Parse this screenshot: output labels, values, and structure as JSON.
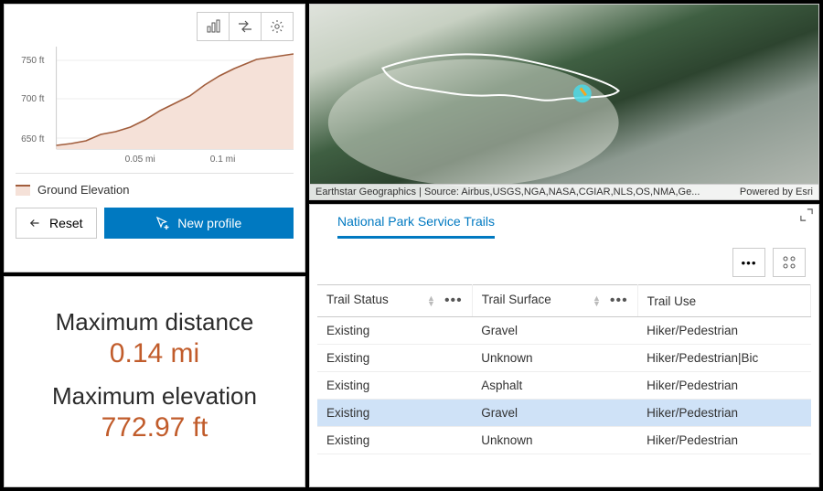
{
  "profile": {
    "legend_label": "Ground Elevation",
    "reset_label": "Reset",
    "new_profile_label": "New profile"
  },
  "chart_data": {
    "type": "area",
    "xlabel": "",
    "ylabel": "",
    "x_ticks": [
      "0.05 mi",
      "0.1 mi"
    ],
    "y_ticks": [
      "650 ft",
      "700 ft",
      "750 ft"
    ],
    "xlim": [
      0,
      0.14
    ],
    "ylim": [
      640,
      780
    ],
    "series": [
      {
        "name": "Ground Elevation",
        "x": [
          0,
          0.01,
          0.02,
          0.03,
          0.04,
          0.05,
          0.06,
          0.07,
          0.08,
          0.09,
          0.1,
          0.11,
          0.12,
          0.13,
          0.14
        ],
        "values": [
          645,
          650,
          655,
          665,
          670,
          678,
          688,
          700,
          710,
          720,
          735,
          748,
          758,
          768,
          773
        ]
      }
    ]
  },
  "stats": {
    "max_dist_label": "Maximum distance",
    "max_dist_value": "0.14 mi",
    "max_elev_label": "Maximum elevation",
    "max_elev_value": "772.97 ft"
  },
  "map": {
    "attribution_left": "Earthstar Geographics | Source: Airbus,USGS,NGA,NASA,CGIAR,NLS,OS,NMA,Ge...",
    "attribution_right": "Powered by Esri"
  },
  "table": {
    "tab_label": "National Park Service Trails",
    "columns": [
      "Trail Status",
      "Trail Surface",
      "Trail Use"
    ],
    "rows": [
      {
        "status": "Existing",
        "surface": "Gravel",
        "use": "Hiker/Pedestrian",
        "selected": false
      },
      {
        "status": "Existing",
        "surface": "Unknown",
        "use": "Hiker/Pedestrian|Bic",
        "selected": false
      },
      {
        "status": "Existing",
        "surface": "Asphalt",
        "use": "Hiker/Pedestrian",
        "selected": false
      },
      {
        "status": "Existing",
        "surface": "Gravel",
        "use": "Hiker/Pedestrian",
        "selected": true
      },
      {
        "status": "Existing",
        "surface": "Unknown",
        "use": "Hiker/Pedestrian",
        "selected": false
      }
    ]
  }
}
